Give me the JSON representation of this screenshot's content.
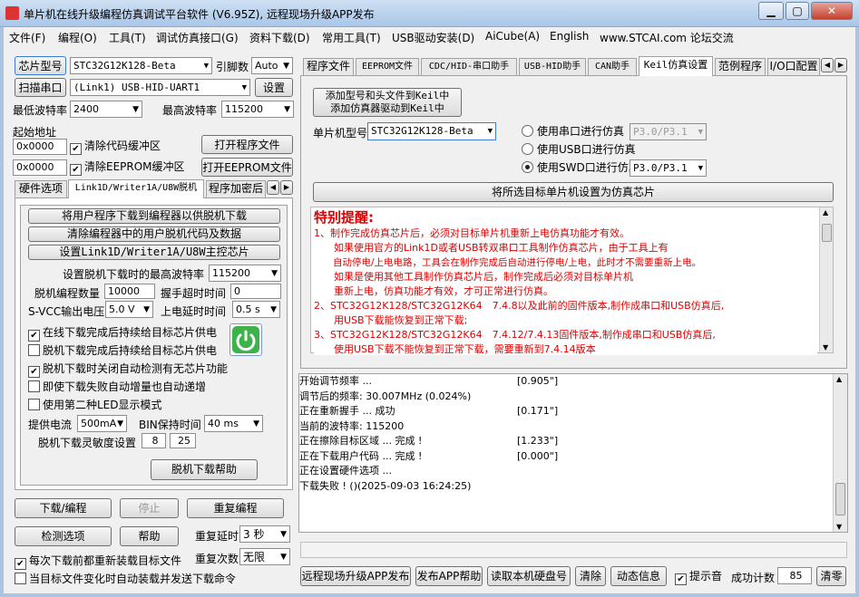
{
  "window": {
    "title": "单片机在线升级编程仿真调试平台软件 (V6.95Z), 远程现场升级APP发布"
  },
  "menu": [
    "文件(F)",
    "编程(O)",
    "工具(T)",
    "调试仿真接口(G)",
    "资料下载(D)",
    "常用工具(T)",
    "USB驱动安装(D)",
    "AiCube(A)",
    "English",
    "www.STCAI.com 论坛交流"
  ],
  "left": {
    "chip_type_btn": "芯片型号",
    "chip_value": "STC32G12K128-Beta",
    "pin_label": "引脚数",
    "pin_value": "Auto",
    "scan_btn": "扫描串口",
    "port_value": "(Link1) USB-HID-UART1",
    "settings_btn": "设置",
    "min_baud_label": "最低波特率",
    "min_baud": "2400",
    "max_baud_label": "最高波特率",
    "max_baud": "115200",
    "start_addr_label": "起始地址",
    "addr1": "0x0000",
    "clear_code": "清除代码缓冲区",
    "open_prog": "打开程序文件",
    "addr2": "0x0000",
    "clear_eeprom": "清除EEPROM缓冲区",
    "open_eeprom": "打开EEPROM文件",
    "tabs": [
      "硬件选项",
      "Link1D/Writer1A/U8W脱机",
      "程序加密后"
    ],
    "offline": {
      "btn1": "将用户程序下载到编程器以供脱机下载",
      "btn2": "清除编程器中的用户脱机代码及数据",
      "btn3": "设置Link1D/Writer1A/U8W主控芯片",
      "max_baud_label": "设置脱机下载时的最高波特率",
      "max_baud": "115200",
      "count_label": "脱机编程数量",
      "count": "10000",
      "timeout_label": "握手超时时间",
      "timeout": "0",
      "vcc_label": "S-VCC输出电压",
      "vcc": "5.0 V",
      "delay_label": "上电延时时间",
      "delay": "0.5 s",
      "opts": [
        "在线下载完成后持续给目标芯片供电",
        "脱机下载完成后持续给目标芯片供电",
        "脱机下载时关闭自动检测有无芯片功能",
        "即使下载失败自动增量也自动递增",
        "使用第二种LED显示模式"
      ],
      "opts_checked": [
        true,
        false,
        true,
        false,
        false
      ],
      "current_label": "提供电流",
      "current": "500mA",
      "bin_label": "BIN保持时间",
      "bin": "40 ms",
      "sens_label": "脱机下载灵敏度设置",
      "sens1": "8",
      "sens2": "25",
      "help_btn": "脱机下载帮助"
    },
    "download_btn": "下载/编程",
    "stop_btn": "停止",
    "reprog_btn": "重复编程",
    "check_btn": "检测选项",
    "help_btn": "帮助",
    "repeat_delay_label": "重复延时",
    "repeat_delay": "3 秒",
    "reload_label": "每次下载前都重新装载目标文件",
    "repeat_count_label": "重复次数",
    "repeat_count": "无限",
    "auto_label": "当目标文件变化时自动装载并发送下载命令"
  },
  "right": {
    "tabs": [
      "程序文件",
      "EEPROM文件",
      "CDC/HID-串口助手",
      "USB-HID助手",
      "CAN助手",
      "Keil仿真设置",
      "范例程序",
      "I/O口配置"
    ],
    "keil": {
      "add_btn_line1": "添加型号和头文件到Keil中",
      "add_btn_line2": "添加仿真器驱动到Keil中",
      "mcu_label": "单片机型号",
      "mcu_value": "STC32G12K128-Beta",
      "radio_serial": "使用串口进行仿真",
      "serial_pins": "P3.0/P3.1",
      "radio_usb": "使用USB口进行仿真",
      "radio_swd": "使用SWD口进行仿真",
      "swd_pins": "P3.0/P3.1",
      "set_btn": "将所选目标单片机设置为仿真芯片"
    },
    "warning_title": "特别提醒:",
    "warning_lines": [
      "1、制作完成仿真芯片后，必须对目标单片机重新上电仿真功能才有效。",
      "　　如果使用官方的Link1D或者USB转双串口工具制作仿真芯片，由于工具上有",
      "　　自动停电/上电电路，工具会在制作完成后自动进行停电/上电，此时才不需要重新上电。",
      "　　如果是使用其他工具制作仿真芯片后，制作完成后必须对目标单片机",
      "　　重新上电，仿真功能才有效，才可正常进行仿真。",
      "2、STC32G12K128/STC32G12K64　7.4.8以及此前的固件版本,制作成串口和USB仿真后,",
      "　　用USB下载能恢复到正常下载;",
      "3、STC32G12K128/STC32G12K64　7.4.12/7.4.13固件版本,制作成串口和USB仿真后,",
      "　　使用USB下载不能恢复到正常下载，需要重新到7.4.14版本"
    ],
    "log": [
      [
        "",
        ""
      ],
      [
        "开始调节频率 ...",
        "[0.905\"]"
      ],
      [
        "调节后的频率: 30.007MHz (0.024%)",
        ""
      ],
      [
        "",
        ""
      ],
      [
        "正在重新握手 ... 成功",
        "[0.171\"]"
      ],
      [
        "当前的波特率: 115200",
        ""
      ],
      [
        "正在擦除目标区域 ... 完成 !",
        "[1.233\"]"
      ],
      [
        "正在下载用户代码 ... 完成 !",
        "[0.000\"]"
      ],
      [
        "正在设置硬件选项 ...",
        ""
      ],
      [
        "下载失败 ! ()(2025-09-03 16:24:25)",
        ""
      ]
    ],
    "bottom": {
      "publish_btn": "远程现场升级APP发布",
      "publish_help": "发布APP帮助",
      "read_disk": "读取本机硬盘号",
      "clear_btn": "清除",
      "anim_btn": "动态信息",
      "beep_label": "提示音",
      "success_label": "成功计数",
      "success_count": "85",
      "clear_count": "清零"
    }
  },
  "colors": {
    "title_bg": "#b9d1ea",
    "warning_text": "#e00000",
    "power_icon": "#3cb34a"
  }
}
